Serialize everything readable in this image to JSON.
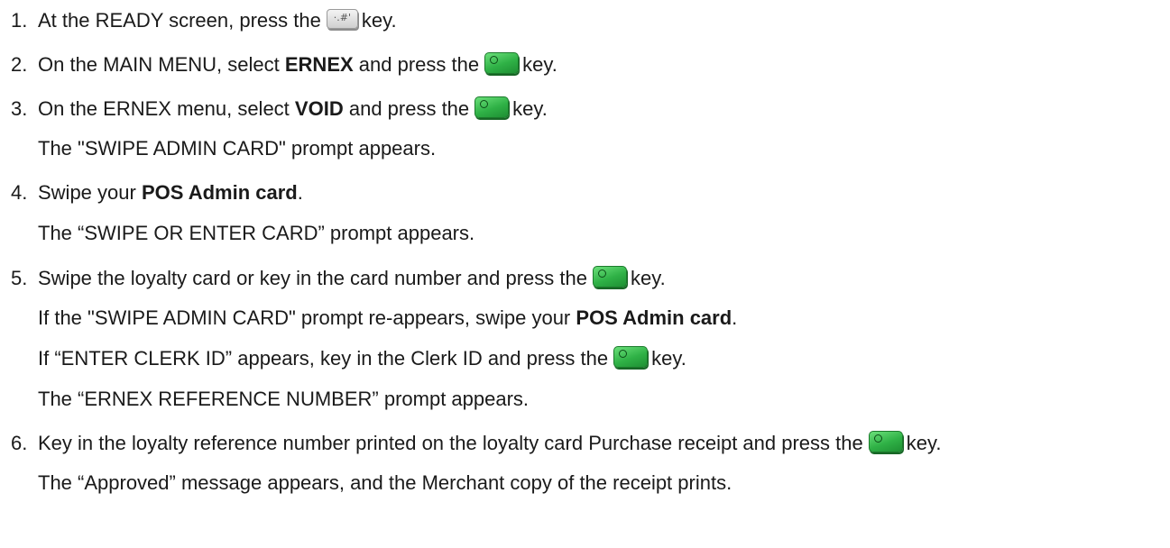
{
  "steps": [
    {
      "number": "1.",
      "parts": [
        "At the READY screen, press the",
        "key."
      ],
      "key": "hash-key-icon"
    },
    {
      "number": "2.",
      "parts": [
        "On the MAIN MENU, select",
        "ERNEX",
        "and press the",
        "key."
      ],
      "key": "ok-key-icon"
    },
    {
      "number": "3.",
      "parts": [
        "On the ERNEX menu, select",
        "VOID",
        "and press the",
        "key."
      ],
      "key": "ok-key-icon",
      "note": "The \"SWIPE ADMIN CARD\" prompt appears."
    },
    {
      "number": "4.",
      "parts": [
        "Swipe your",
        "POS Admin card",
        "."
      ],
      "note": "The “SWIPE OR ENTER CARD” prompt appears."
    },
    {
      "number": "5.",
      "parts": [
        "Swipe the loyalty card or key in the card number and press the",
        "key."
      ],
      "key": "ok-key-icon",
      "notes": [
        "If the \"SWIPE ADMIN CARD\" prompt re-appears, swipe your",
        "POS Admin card",
        ".",
        "If “ENTER CLERK ID” appears, key in the Clerk ID and press the",
        "key.",
        "The “ERNEX REFERENCE NUMBER” prompt appears."
      ]
    },
    {
      "number": "6.",
      "parts": [
        "Key in the loyalty reference number printed on the loyalty card Purchase receipt and press the",
        "key."
      ],
      "key": "ok-key-icon",
      "note": "The “Approved” message appears, and the Merchant copy of the receipt prints."
    }
  ],
  "keys": {
    "hash_key_glyph": "·.#'",
    "ok_key_color": "#2fb146"
  }
}
